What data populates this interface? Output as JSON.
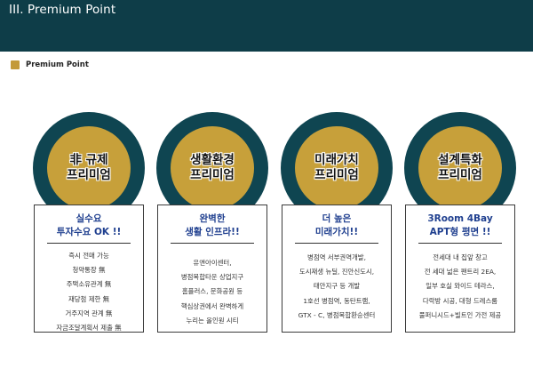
{
  "header": {
    "title": "III. Premium Point"
  },
  "section": {
    "label": "Premium Point"
  },
  "colors": {
    "header_bg": "#0e3d48",
    "ring": "#0f4551",
    "gold": "#c7a03a",
    "heading_blue": "#1f3f8f"
  },
  "cards": [
    {
      "badge": [
        "非 규제",
        "프리미엄"
      ],
      "heading": [
        "실수요",
        "투자수요 OK !!"
      ],
      "items": [
        "즉시 전매 가능",
        "청약통장 無",
        "주택소유관계 無",
        "재당첨 제한 無",
        "거주지역 관계 無",
        "자금조달계획서 제출 無"
      ]
    },
    {
      "badge": [
        "생활환경",
        "프리미엄"
      ],
      "heading": [
        "완벽한",
        "생활 인프라!!"
      ],
      "items": [
        "유앤아이센터,",
        "병점복합타운 상업지구",
        "홈플러스, 문화공원 등",
        "핵심상권에서 완벽하게",
        "누리는 올인원 시티"
      ]
    },
    {
      "badge": [
        "미래가치",
        "프리미엄"
      ],
      "heading": [
        "더 높은",
        "미래가치!!"
      ],
      "items": [
        "병점역 서부권역개발,",
        "도시재생 뉴딜, 진안신도시,",
        "태안지구 등 개발",
        "1호선 병점역, 동탄트램,",
        "GTX - C, 병점복합환승센터"
      ]
    },
    {
      "badge": [
        "설계특화",
        "프리미엄"
      ],
      "heading": [
        "3Room 4Bay",
        "APT형 평면 !!"
      ],
      "items": [
        "전세대 내 집앞 창고",
        "전 세대 넓은 팬트리 2EA,",
        "일부 호실 와이드 테라스,",
        "다락방 시공, 대형 드레스룸",
        "풀퍼니시드+빌트인 가전 제공"
      ]
    }
  ]
}
